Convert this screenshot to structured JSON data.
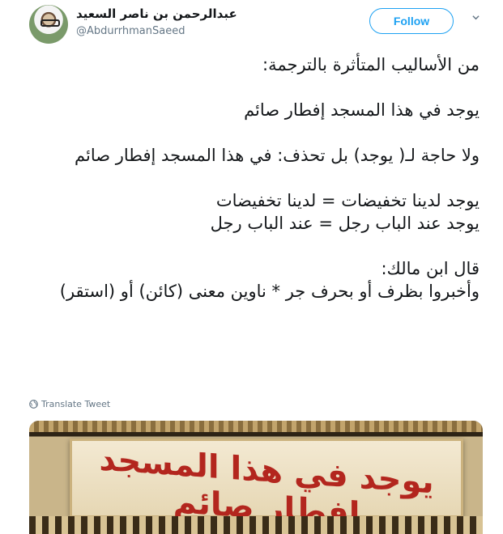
{
  "header": {
    "display_name": "عبدالرحمن بن ناصر السعيد",
    "handle": "@AbdurrhmanSaeed",
    "follow_label": "Follow"
  },
  "tweet": {
    "lines": [
      "من الأساليب المتأثرة بالترجمة:",
      "",
      "يوجد في هذا المسجد إفطار صائم",
      "",
      "ولا حاجة لـ( يوجد) بل تحذف: في هذا المسجد إفطار صائم",
      "",
      "يوجد لدينا تخفيضات = لدينا تخفيضات",
      "يوجد عند الباب رجل = عند الباب رجل",
      "",
      "قال ابن مالك:",
      "وأخبروا بظرف أو بحرف جر * ناوين معنى (كائن) أو (استقر)"
    ]
  },
  "translate_label": "Translate Tweet",
  "media": {
    "sign_text": "يوجد في هذا المسجد إفطار صائم"
  },
  "colors": {
    "accent": "#1da1f2",
    "secondary_text": "#657786",
    "sign_text": "#b3261e"
  },
  "icons": [
    "avatar",
    "chevron-down-icon",
    "globe-icon"
  ]
}
